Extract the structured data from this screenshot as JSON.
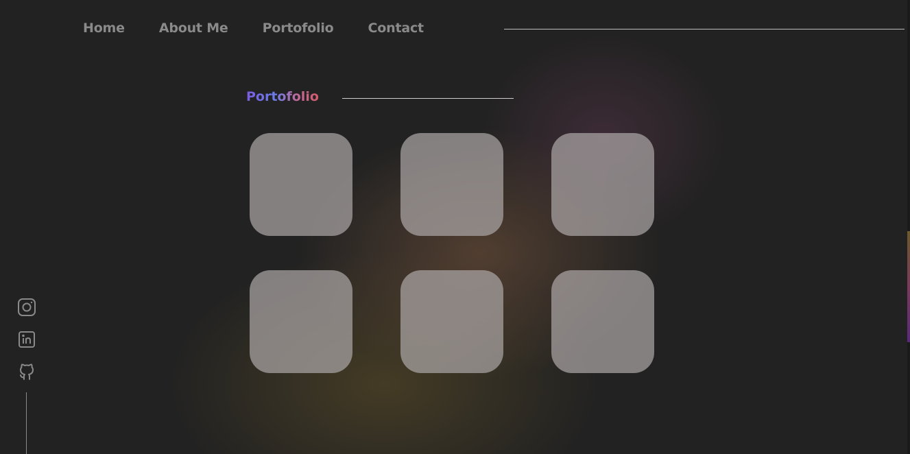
{
  "nav": {
    "items": [
      {
        "label": "Home"
      },
      {
        "label": "About Me"
      },
      {
        "label": "Portofolio"
      },
      {
        "label": "Contact"
      }
    ]
  },
  "portfolio": {
    "title": "Portofolio",
    "cards": [
      {
        "id": 1
      },
      {
        "id": 2
      },
      {
        "id": 3
      },
      {
        "id": 4
      },
      {
        "id": 5
      },
      {
        "id": 6
      }
    ]
  },
  "social": {
    "icons": [
      "instagram-icon",
      "linkedin-icon",
      "github-icon"
    ]
  },
  "colors": {
    "background": "#222222",
    "nav_text": "#8a8a8a",
    "card": "#aaa5a5",
    "title_gradient": [
      "#7b5ce0",
      "#6a7ce8",
      "#c06a9a",
      "#d45a6a"
    ]
  }
}
